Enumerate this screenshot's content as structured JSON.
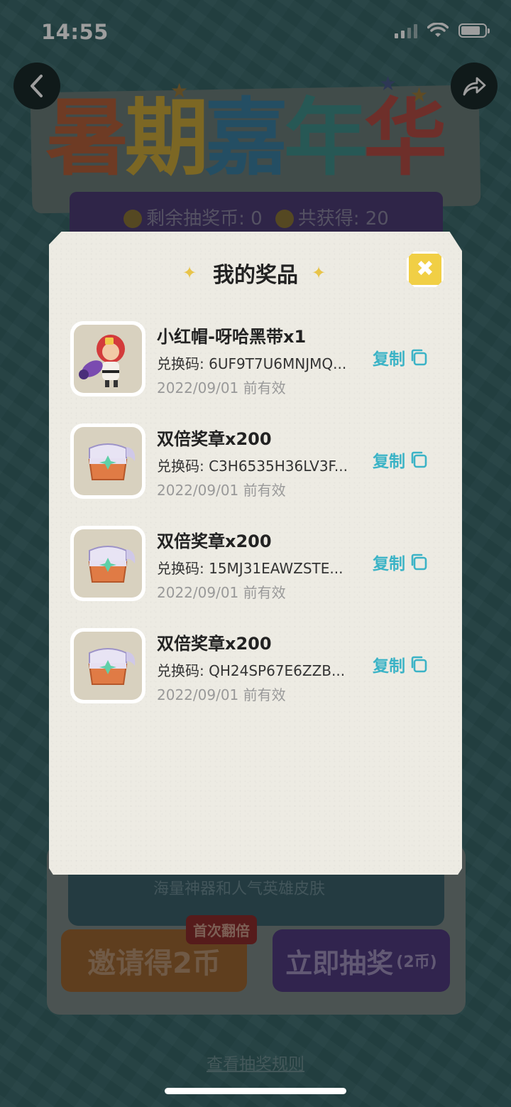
{
  "status_bar": {
    "time": "14:55"
  },
  "banner": {
    "title_chars": [
      "暑",
      "期",
      "嘉",
      "年",
      "华"
    ],
    "coin_remaining_label": "剩余抽奖币: 0",
    "coin_total_label": "共获得: 20"
  },
  "lower": {
    "hint_text": "海量神器和人气英雄皮肤",
    "invite_button": "邀请得2币",
    "first_badge": "首次翻倍",
    "draw_button": "立即抽奖",
    "draw_cost": "(2币)"
  },
  "rules_link": "查看抽奖规则",
  "modal": {
    "title": "我的奖品",
    "close_icon": "close-x-icon",
    "prizes": [
      {
        "name": "小红帽-呀哈黑带x1",
        "code": "兑换码: 6UF9T7U6MNJMQ...",
        "expiry": "2022/09/01 前有效",
        "copy_label": "复制",
        "icon": "red-hood-character"
      },
      {
        "name": "双倍奖章x200",
        "code": "兑换码: C3H6535H36LV3F...",
        "expiry": "2022/09/01 前有效",
        "copy_label": "复制",
        "icon": "treasure-chest"
      },
      {
        "name": "双倍奖章x200",
        "code": "兑换码: 15MJ31EAWZSTE...",
        "expiry": "2022/09/01 前有效",
        "copy_label": "复制",
        "icon": "treasure-chest"
      },
      {
        "name": "双倍奖章x200",
        "code": "兑换码: QH24SP67E6ZZB...",
        "expiry": "2022/09/01 前有效",
        "copy_label": "复制",
        "icon": "treasure-chest"
      }
    ]
  },
  "colors": {
    "accent_copy": "#3bb3c6",
    "close_button": "#f1cf45",
    "modal_bg": "#edebe3"
  }
}
